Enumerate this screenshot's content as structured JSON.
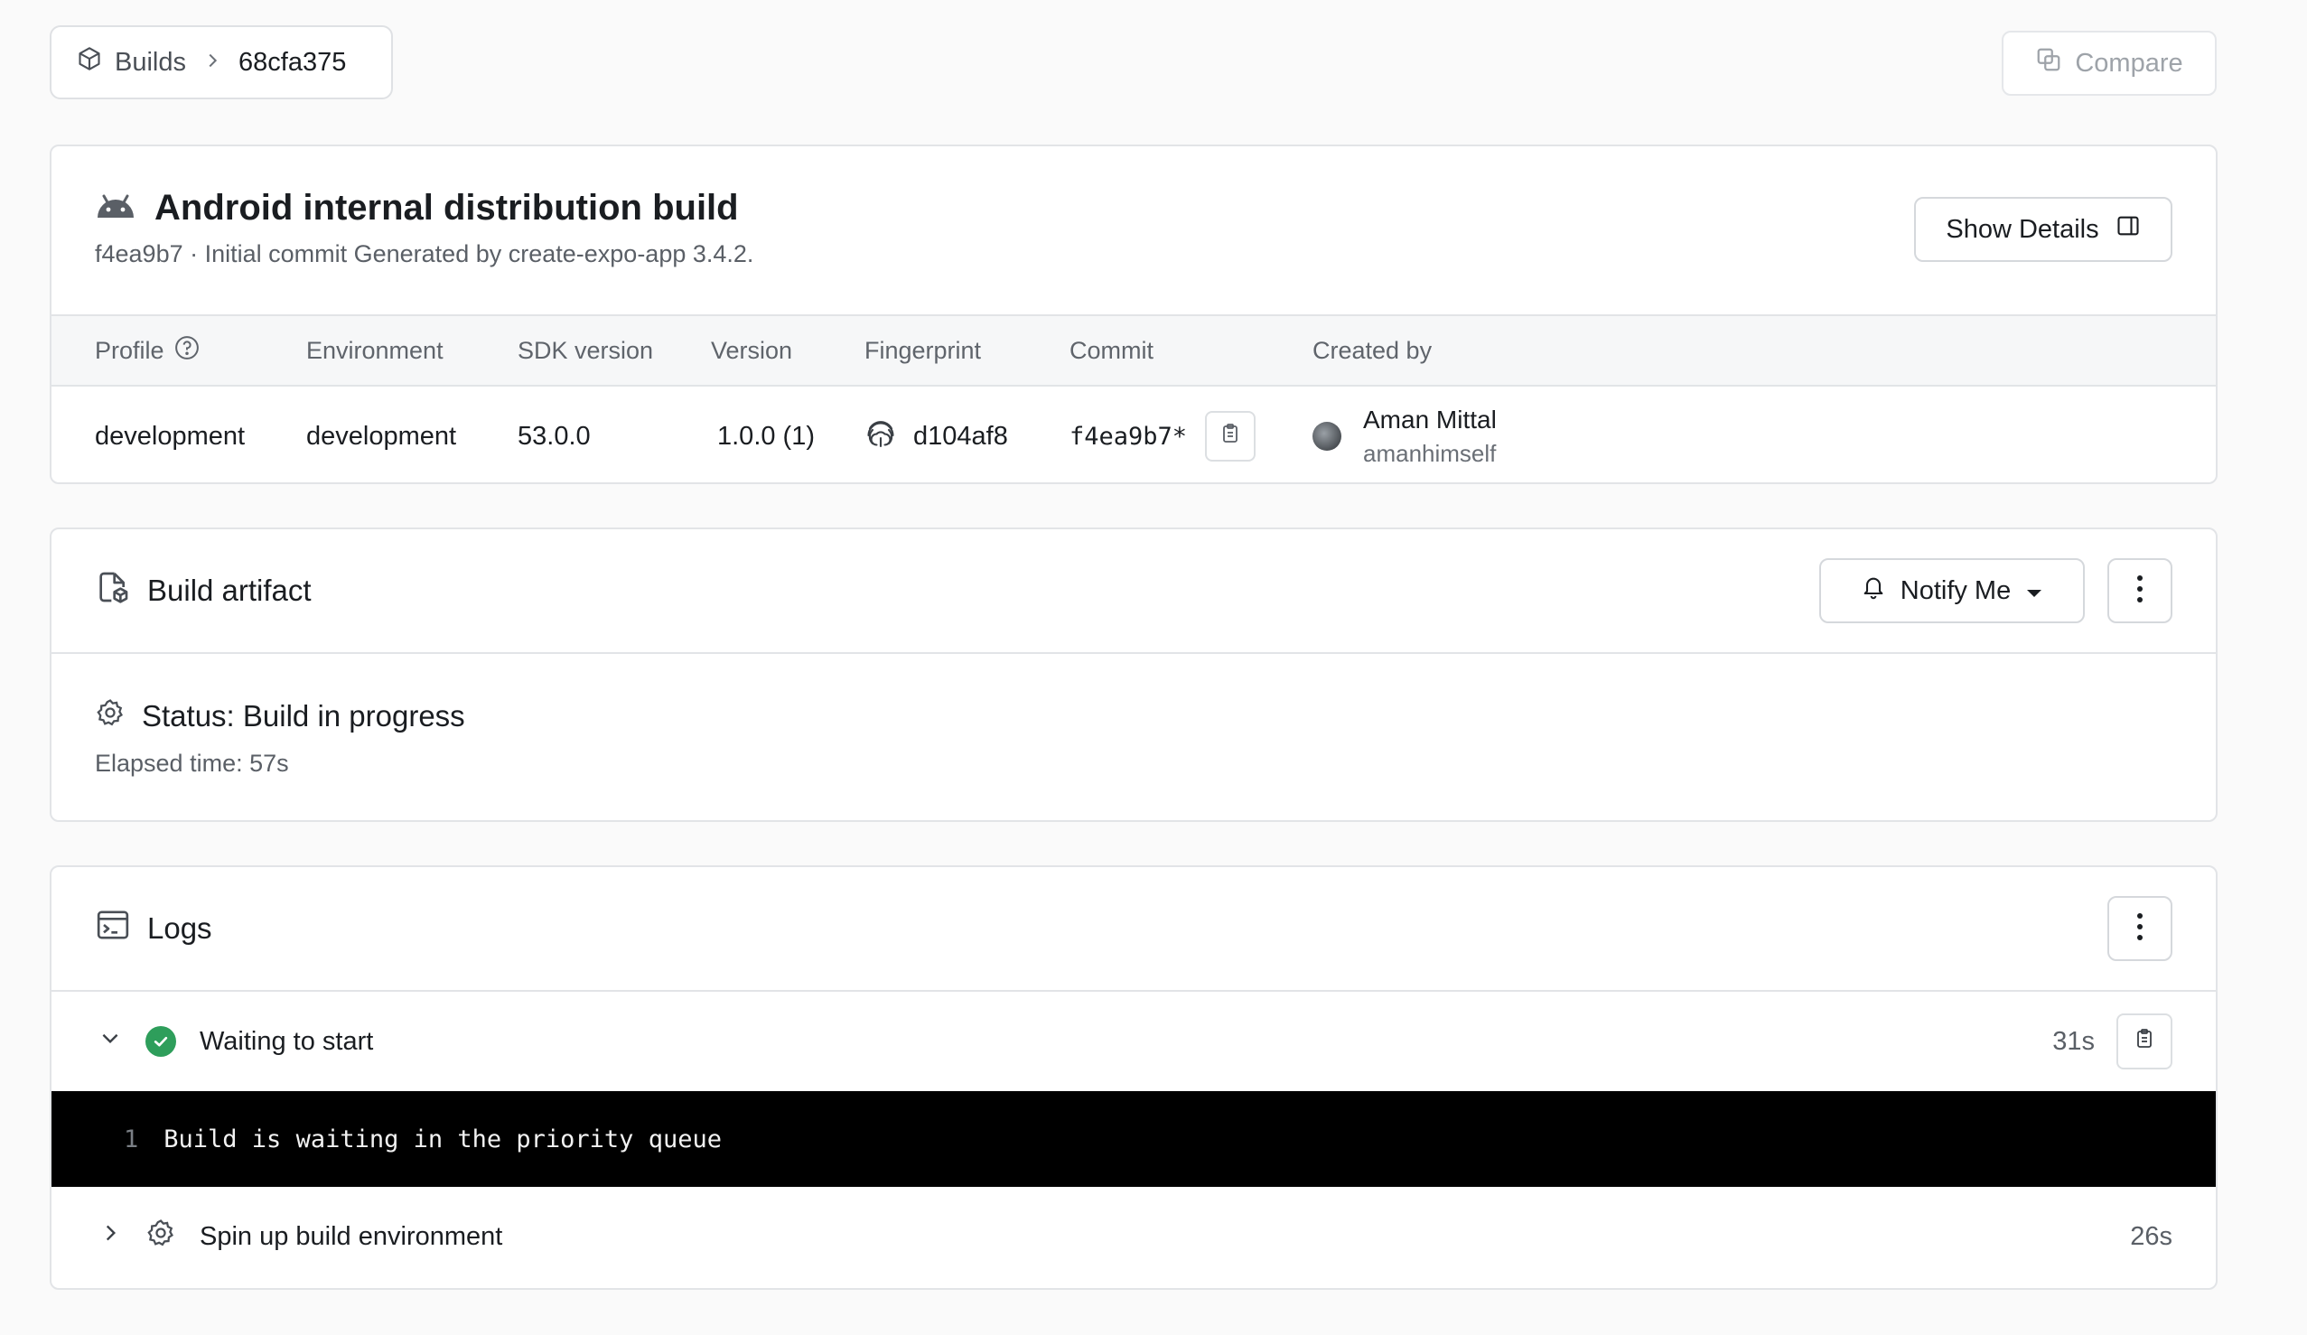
{
  "breadcrumb": {
    "root": "Builds",
    "current": "68cfa375"
  },
  "toolbar": {
    "compare_label": "Compare"
  },
  "build": {
    "title": "Android internal distribution build",
    "subtitle": "f4ea9b7 · Initial commit Generated by create-expo-app 3.4.2.",
    "show_details_label": "Show Details",
    "columns": [
      "Profile",
      "Environment",
      "SDK version",
      "Version",
      "Fingerprint",
      "Commit",
      "Created by"
    ],
    "values": {
      "profile": "development",
      "environment": "development",
      "sdk_version": "53.0.0",
      "version": "1.0.0 (1)",
      "fingerprint": "d104af8",
      "commit": "f4ea9b7*",
      "creator_name": "Aman Mittal",
      "creator_handle": "amanhimself"
    }
  },
  "artifact": {
    "title": "Build artifact",
    "notify_label": "Notify Me",
    "status": "Status: Build in progress",
    "elapsed_label": "Elapsed time:",
    "elapsed_value": "57s"
  },
  "logs": {
    "title": "Logs",
    "steps": [
      {
        "label": "Waiting to start",
        "duration": "31s"
      },
      {
        "label": "Spin up build environment",
        "duration": "26s"
      }
    ],
    "terminal": {
      "line_number": "1",
      "text": "Build is waiting in the priority queue"
    }
  },
  "colors": {
    "success": "#2e9e5b",
    "border": "#e2e4e7",
    "terminal_bg": "#000000"
  }
}
